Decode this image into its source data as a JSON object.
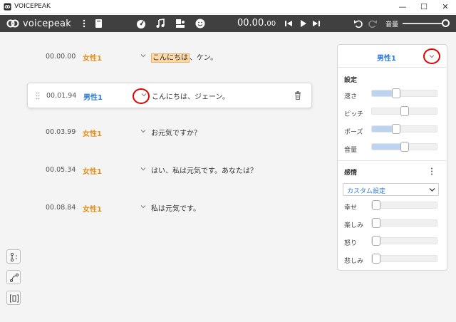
{
  "window": {
    "title": "VOICEPEAK",
    "minimize": "—",
    "maximize": "☐",
    "close": "✕"
  },
  "toolbar": {
    "logo_text": "voicepeak",
    "timecode_main": "00.00.",
    "timecode_small": "00",
    "volume_label": "音量",
    "volume_level": 0.9
  },
  "rows": [
    {
      "time": "00.00.00",
      "speaker": "女性1",
      "text_highlight": "こんにちは",
      "text_rest": "、ケン。"
    },
    {
      "time": "00.01.94",
      "speaker": "男性1",
      "text": "こんにちは、ジェーン。"
    },
    {
      "time": "00.03.99",
      "speaker": "女性1",
      "text": "お元気ですか？"
    },
    {
      "time": "00.05.34",
      "speaker": "女性1",
      "text": "はい、私は元気です。あなたは？"
    },
    {
      "time": "00.08.84",
      "speaker": "女性1",
      "text": "私は元気です。"
    }
  ],
  "panel": {
    "speaker": "男性1",
    "settings_title": "設定",
    "settings": [
      {
        "label": "速さ",
        "value": 0.35
      },
      {
        "label": "ピッチ",
        "value": 0.5
      },
      {
        "label": "ポーズ",
        "value": 0.35
      },
      {
        "label": "音量",
        "value": 0.5
      }
    ],
    "emotion_title": "感情",
    "preset": "カスタム設定",
    "emotions": [
      {
        "label": "幸せ",
        "value": 0
      },
      {
        "label": "楽しみ",
        "value": 0
      },
      {
        "label": "怒り",
        "value": 0
      },
      {
        "label": "悲しみ",
        "value": 0
      }
    ]
  },
  "icons": {
    "menu": "kebab-icon",
    "script": "book-icon",
    "speed": "gauge-icon",
    "music": "music-note-icon",
    "speaker": "speaker-select-icon",
    "emotion": "smiley-icon",
    "skip_back": "skip-back-icon",
    "play": "play-icon",
    "skip_forward": "skip-forward-icon",
    "undo": "undo-icon",
    "redo": "redo-icon"
  },
  "colors": {
    "toolbar_bg": "#404040",
    "female": "#e0901a",
    "male": "#2a7ad6",
    "highlight": "#fbd9a8",
    "annotation_red": "#e00000",
    "slider_fill": "#bcd3f2"
  }
}
